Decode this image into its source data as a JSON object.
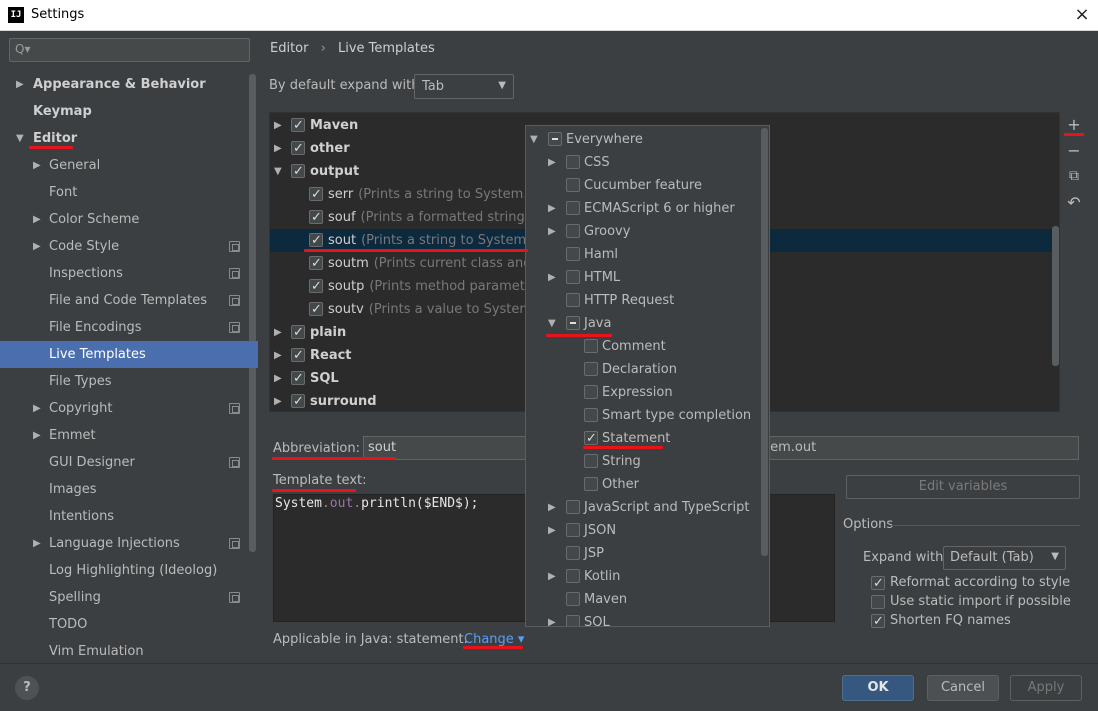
{
  "window": {
    "title": "Settings",
    "logo_text": "IJ",
    "close_icon": "×"
  },
  "search": {
    "placeholder": "",
    "icon": "Q▾"
  },
  "sidebar": {
    "items": [
      {
        "label": "Appearance & Behavior",
        "arrow": "▶",
        "bold": true
      },
      {
        "label": "Keymap",
        "bold": true
      },
      {
        "label": "Editor",
        "arrow": "▼",
        "bold": true
      },
      {
        "label": "General",
        "arrow": "▶"
      },
      {
        "label": "Font"
      },
      {
        "label": "Color Scheme",
        "arrow": "▶"
      },
      {
        "label": "Code Style",
        "arrow": "▶",
        "project_icon": true
      },
      {
        "label": "Inspections",
        "project_icon": true
      },
      {
        "label": "File and Code Templates",
        "project_icon": true
      },
      {
        "label": "File Encodings",
        "project_icon": true
      },
      {
        "label": "Live Templates",
        "selected": true
      },
      {
        "label": "File Types"
      },
      {
        "label": "Copyright",
        "arrow": "▶",
        "project_icon": true
      },
      {
        "label": "Emmet",
        "arrow": "▶"
      },
      {
        "label": "GUI Designer",
        "project_icon": true
      },
      {
        "label": "Images"
      },
      {
        "label": "Intentions"
      },
      {
        "label": "Language Injections",
        "arrow": "▶",
        "project_icon": true
      },
      {
        "label": "Log Highlighting (Ideolog)"
      },
      {
        "label": "Spelling",
        "project_icon": true
      },
      {
        "label": "TODO"
      },
      {
        "label": "Vim Emulation"
      }
    ]
  },
  "breadcrumb": {
    "parent": "Editor",
    "separator": "›",
    "current": "Live Templates"
  },
  "expand": {
    "label": "By default expand with",
    "value": "Tab",
    "arrow": "▼"
  },
  "templates": {
    "groups": [
      {
        "name": "Maven",
        "checked": true,
        "expanded": false
      },
      {
        "name": "other",
        "checked": true,
        "expanded": false
      },
      {
        "name": "output",
        "checked": true,
        "expanded": true,
        "items": [
          {
            "name": "serr",
            "desc": "(Prints a string to System.err"
          },
          {
            "name": "souf",
            "desc": "(Prints a formatted string to"
          },
          {
            "name": "sout",
            "desc": "(Prints a string to System.ou",
            "selected": true
          },
          {
            "name": "soutm",
            "desc": "(Prints current class and m"
          },
          {
            "name": "soutp",
            "desc": "(Prints method parameter"
          },
          {
            "name": "soutv",
            "desc": "(Prints a value to System.ou"
          }
        ]
      },
      {
        "name": "plain",
        "checked": true,
        "expanded": false
      },
      {
        "name": "React",
        "checked": true,
        "expanded": false
      },
      {
        "name": "SQL",
        "checked": true,
        "expanded": false
      },
      {
        "name": "surround",
        "checked": true,
        "expanded": false
      }
    ]
  },
  "toolbar": {
    "add": "+",
    "remove": "−",
    "copy": "⧉",
    "restore": "↶"
  },
  "abbreviation": {
    "label": "Abbreviation:",
    "value": "sout",
    "description_tail": "tem.out"
  },
  "template_text": {
    "label": "Template text:",
    "code_a": "System",
    "code_b": "out",
    "code_c": "println($END$);",
    "dot": "."
  },
  "edit_variables": "Edit variables",
  "options": {
    "title": "Options",
    "expand_with_label": "Expand with",
    "expand_with_value": "Default (Tab)",
    "expand_arrow": "▼",
    "checks": [
      {
        "label": "Reformat according to style",
        "checked": true
      },
      {
        "label": "Use static import if possible",
        "checked": false
      },
      {
        "label": "Shorten FQ names",
        "checked": true
      }
    ]
  },
  "applicable": {
    "text": "Applicable in Java: statement.",
    "change": "Change ▾"
  },
  "popup": {
    "items": [
      {
        "name": "Everywhere",
        "state": "mixed",
        "arrow": "▼",
        "level": 0
      },
      {
        "name": "CSS",
        "state": "off",
        "arrow": "▶",
        "level": 1
      },
      {
        "name": "Cucumber feature",
        "state": "off",
        "level": 1
      },
      {
        "name": "ECMAScript 6 or higher",
        "state": "off",
        "arrow": "▶",
        "level": 1
      },
      {
        "name": "Groovy",
        "state": "off",
        "arrow": "▶",
        "level": 1
      },
      {
        "name": "Haml",
        "state": "off",
        "level": 1
      },
      {
        "name": "HTML",
        "state": "off",
        "arrow": "▶",
        "level": 1
      },
      {
        "name": "HTTP Request",
        "state": "off",
        "level": 1
      },
      {
        "name": "Java",
        "state": "mixed",
        "arrow": "▼",
        "level": 1
      },
      {
        "name": "Comment",
        "state": "off",
        "level": 2
      },
      {
        "name": "Declaration",
        "state": "off",
        "level": 2
      },
      {
        "name": "Expression",
        "state": "off",
        "level": 2
      },
      {
        "name": "Smart type completion",
        "state": "off",
        "level": 2
      },
      {
        "name": "Statement",
        "state": "on",
        "level": 2
      },
      {
        "name": "String",
        "state": "off",
        "level": 2
      },
      {
        "name": "Other",
        "state": "off",
        "level": 2
      },
      {
        "name": "JavaScript and TypeScript",
        "state": "off",
        "arrow": "▶",
        "level": 1
      },
      {
        "name": "JSON",
        "state": "off",
        "arrow": "▶",
        "level": 1
      },
      {
        "name": "JSP",
        "state": "off",
        "level": 1
      },
      {
        "name": "Kotlin",
        "state": "off",
        "arrow": "▶",
        "level": 1
      },
      {
        "name": "Maven",
        "state": "off",
        "level": 1
      },
      {
        "name": "SQL",
        "state": "off",
        "arrow": "▶",
        "level": 1
      }
    ]
  },
  "footer": {
    "help": "?",
    "ok": "OK",
    "cancel": "Cancel",
    "apply": "Apply"
  },
  "colors": {
    "accent": "#4b6eaf",
    "annotation": "#e8141b",
    "link": "#589df6",
    "selection": "#0d293e"
  }
}
